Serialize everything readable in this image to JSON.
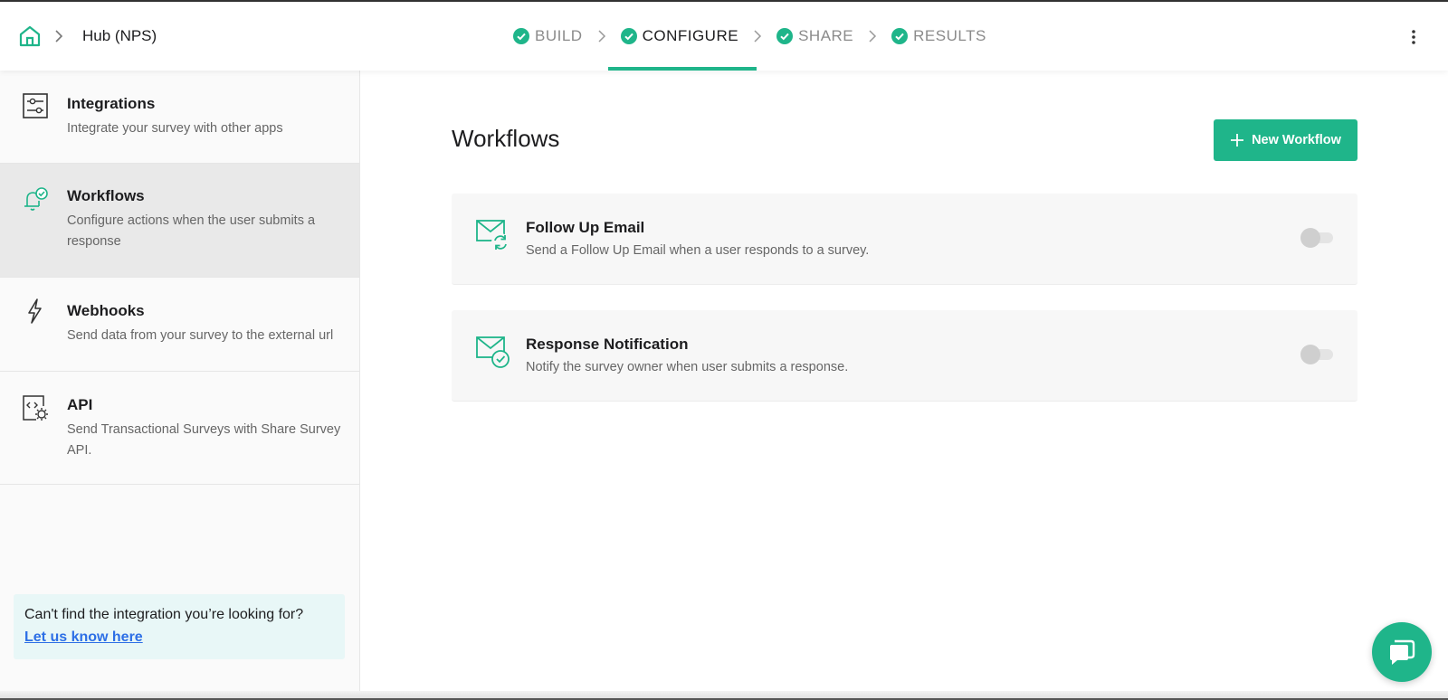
{
  "header": {
    "breadcrumb_title": "Hub (NPS)",
    "steps": [
      {
        "label": "BUILD",
        "active": false
      },
      {
        "label": "CONFIGURE",
        "active": true
      },
      {
        "label": "SHARE",
        "active": false
      },
      {
        "label": "RESULTS",
        "active": false
      }
    ]
  },
  "sidebar": {
    "items": [
      {
        "title": "Integrations",
        "desc": "Integrate your survey with other apps",
        "icon": "sliders-icon"
      },
      {
        "title": "Workflows",
        "desc": "Configure actions when the user submits a response",
        "icon": "bell-check-icon"
      },
      {
        "title": "Webhooks",
        "desc": "Send data from your survey to the external url",
        "icon": "lightning-icon"
      },
      {
        "title": "API",
        "desc": "Send Transactional Surveys with Share Survey API.",
        "icon": "code-gear-icon"
      }
    ],
    "help": {
      "text": "Can't find the integration you’re looking for?",
      "link": "Let us know here"
    }
  },
  "main": {
    "title": "Workflows",
    "new_button": "New Workflow",
    "workflows": [
      {
        "title": "Follow Up Email",
        "desc": "Send a Follow Up Email when a user responds to a survey.",
        "enabled": false
      },
      {
        "title": "Response Notification",
        "desc": "Notify the survey owner when user submits a response.",
        "enabled": false
      }
    ]
  },
  "colors": {
    "accent": "#1fb58a",
    "link": "#2d6fe6",
    "selected_bg": "#e9e9e9",
    "help_bg": "#e8f7f7"
  }
}
